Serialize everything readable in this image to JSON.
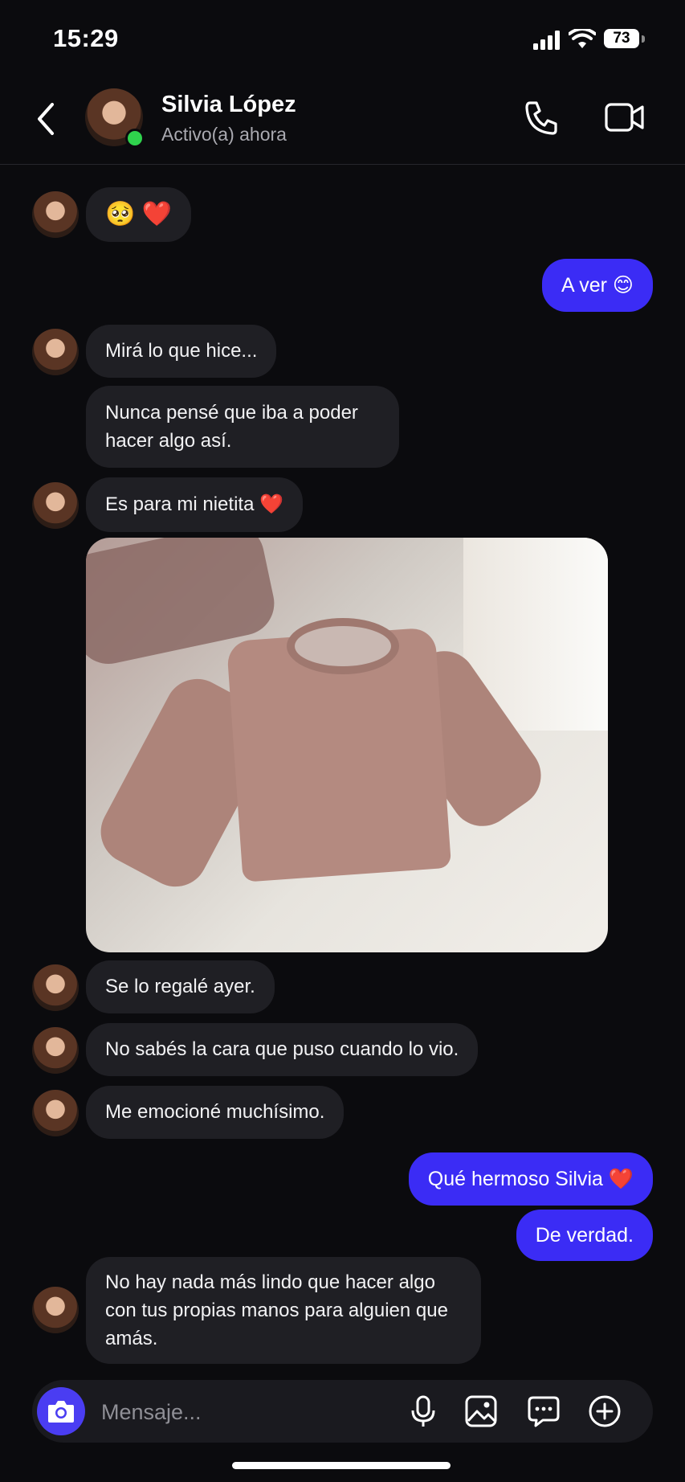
{
  "status_bar": {
    "time": "15:29",
    "battery": "73"
  },
  "header": {
    "contact_name": "Silvia López",
    "contact_status": "Activo(a) ahora"
  },
  "messages": [
    {
      "from": "contact",
      "text": "🥺 ❤️"
    },
    {
      "from": "me",
      "text": "A ver 😊"
    },
    {
      "from": "contact",
      "text": "Mirá lo que hice..."
    },
    {
      "from": "contact",
      "text": "Nunca pensé que iba a poder hacer algo así."
    },
    {
      "from": "contact",
      "text": "Es para mi nietita ❤️"
    },
    {
      "from": "contact",
      "type": "image",
      "description": ""
    },
    {
      "from": "contact",
      "text": "Se lo regalé ayer."
    },
    {
      "from": "contact",
      "text": "No sabés la cara que puso cuando lo vio."
    },
    {
      "from": "contact",
      "text": "Me emocioné muchísimo."
    },
    {
      "from": "me",
      "text": "Qué hermoso Silvia ❤️"
    },
    {
      "from": "me",
      "text": "De verdad."
    },
    {
      "from": "contact",
      "text": "No hay nada más lindo que hacer algo con tus propias manos para alguien que amás."
    }
  ],
  "composer": {
    "placeholder": "Mensaje..."
  },
  "icons": {
    "back": "chevron-left-icon",
    "call": "phone-icon",
    "video": "video-camera-icon",
    "camera": "camera-icon",
    "mic": "microphone-icon",
    "gallery": "image-icon",
    "sticker": "chat-bubble-icon",
    "add": "plus-circle-icon"
  },
  "colors": {
    "outgoing_bubble": "#3b2cf5",
    "incoming_bubble": "#1f1f24",
    "online": "#2fd34d",
    "background": "#0b0b0e"
  }
}
